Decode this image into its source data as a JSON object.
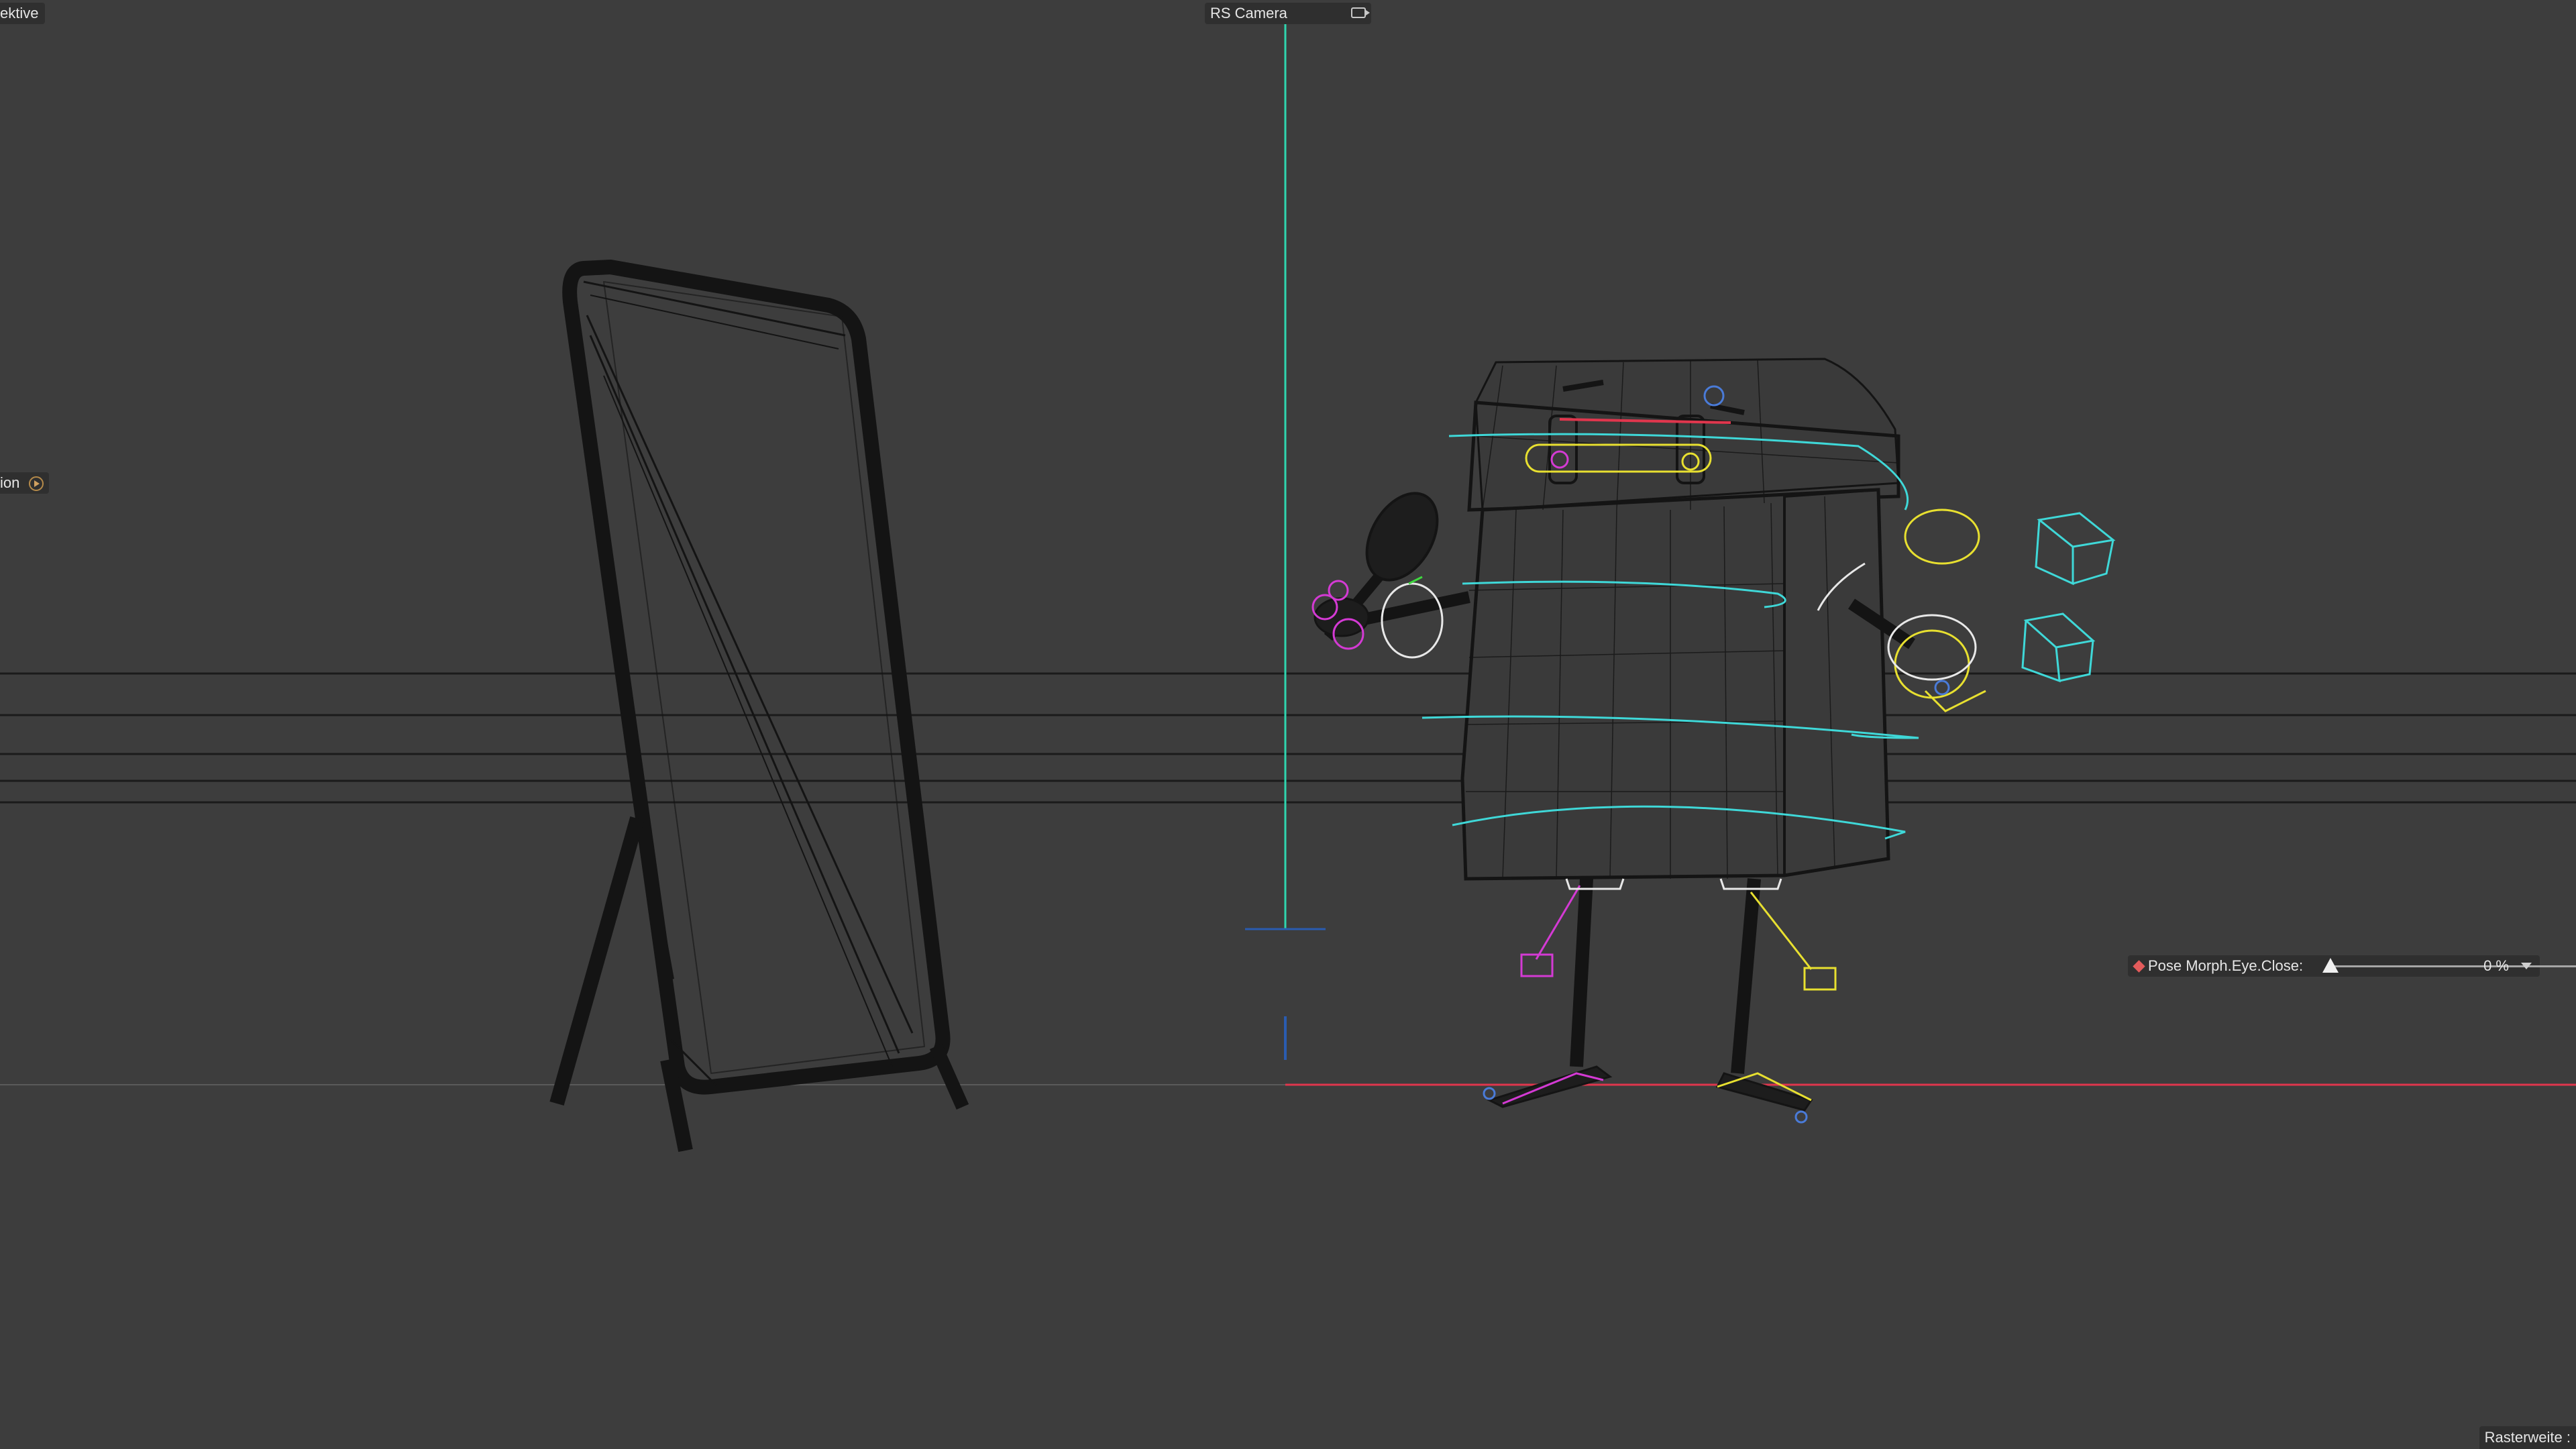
{
  "viewport": {
    "view_label": "ektive",
    "camera_label": "RS Camera",
    "side_label": "ion",
    "status_text": "Rasterweite :"
  },
  "morph": {
    "label": "Pose Morph.Eye.Close:",
    "value": 0,
    "value_text": "0 %"
  },
  "colors": {
    "background": "#3d3d3d",
    "panel": "#2f2f2f",
    "y_axis": "#2fd6b0",
    "x_axis": "#e0364d",
    "controller_cyan": "#3fd8d8",
    "controller_magenta": "#d43ad4",
    "controller_yellow": "#e8e030",
    "wire": "#151515",
    "keyframe": "#e35b5b"
  },
  "icons": {
    "camera": "camera-icon",
    "side_button": "play-icon",
    "morph_key": "keyframe-icon",
    "morph_dropdown": "chevron-down-icon"
  }
}
